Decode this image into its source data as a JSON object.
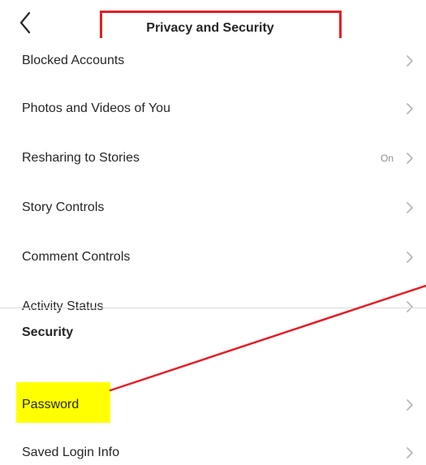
{
  "header": {
    "title": "Privacy and Security",
    "back_icon": "chevron-left-icon"
  },
  "rows": [
    {
      "label": "Blocked Accounts",
      "value": ""
    },
    {
      "label": "Photos and Videos of You",
      "value": ""
    },
    {
      "label": "Resharing to Stories",
      "value": "On"
    },
    {
      "label": "Story Controls",
      "value": ""
    },
    {
      "label": "Comment Controls",
      "value": ""
    },
    {
      "label": "Activity Status",
      "value": ""
    }
  ],
  "security": {
    "section_title": "Security",
    "rows": [
      {
        "label": "Password",
        "value": ""
      },
      {
        "label": "Saved Login Info",
        "value": ""
      }
    ]
  },
  "annotations": {
    "title_box_color": "#e41e26",
    "arrow_color": "#e41e26",
    "highlight_color": "#ffff00"
  }
}
